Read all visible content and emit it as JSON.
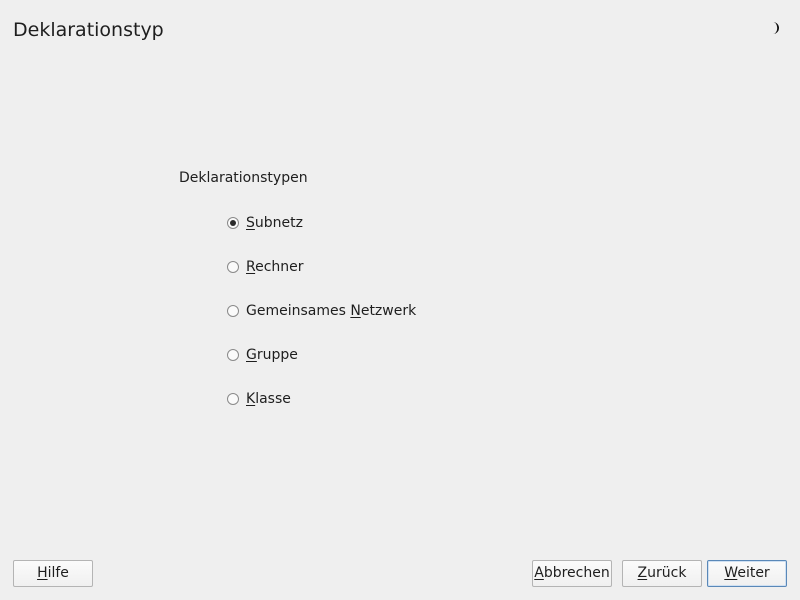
{
  "window": {
    "title": "Deklarationstyp",
    "theme_icon": "moon-icon"
  },
  "group": {
    "label": "Deklarationstypen",
    "options": [
      {
        "pre": "",
        "key": "S",
        "post": "ubnetz",
        "checked": true
      },
      {
        "pre": "",
        "key": "R",
        "post": "echner",
        "checked": false
      },
      {
        "pre": "Gemeinsames ",
        "key": "N",
        "post": "etzwerk",
        "checked": false
      },
      {
        "pre": "",
        "key": "G",
        "post": "ruppe",
        "checked": false
      },
      {
        "pre": "",
        "key": "K",
        "post": "lasse",
        "checked": false
      }
    ]
  },
  "buttons": {
    "help": {
      "key": "H",
      "post": "ilfe"
    },
    "abort": {
      "key": "A",
      "post": "bbrechen"
    },
    "back": {
      "key": "Z",
      "post": "urück"
    },
    "next": {
      "key": "W",
      "post": "eiter"
    }
  },
  "colors": {
    "background": "#efefef",
    "default_button_border": "#5a88b8"
  }
}
